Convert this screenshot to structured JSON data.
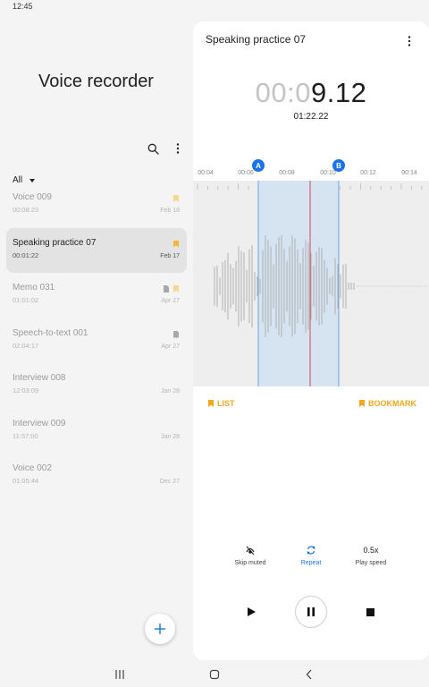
{
  "status_bar": {
    "time": "12:45"
  },
  "left_pane": {
    "title": "Voice recorder",
    "filter_label": "All",
    "recordings": [
      {
        "name": "Voice 009",
        "duration": "00:08:23",
        "date": "Feb 18",
        "bookmark": true,
        "has_doc": false,
        "selected": false
      },
      {
        "name": "Speaking practice 07",
        "duration": "00:01:22",
        "date": "Feb 17",
        "bookmark": true,
        "has_doc": false,
        "selected": true
      },
      {
        "name": "Memo 031",
        "duration": "01:01:02",
        "date": "Apr 27",
        "bookmark": true,
        "has_doc": true,
        "selected": false
      },
      {
        "name": "Speech-to-text 001",
        "duration": "02:04:17",
        "date": "Apr 27",
        "bookmark": false,
        "has_doc": true,
        "selected": false
      },
      {
        "name": "Interview 008",
        "duration": "12:03:09",
        "date": "Jan 28",
        "bookmark": false,
        "has_doc": false,
        "selected": false
      },
      {
        "name": "Interview 009",
        "duration": "11:57:00",
        "date": "Jan 28",
        "bookmark": false,
        "has_doc": false,
        "selected": false
      },
      {
        "name": "Voice 002",
        "duration": "01:05:44",
        "date": "Dec 27",
        "bookmark": false,
        "has_doc": false,
        "selected": false
      }
    ]
  },
  "player": {
    "title": "Speaking practice 07",
    "elapsed_dim": "00:0",
    "elapsed_bright": "9.12",
    "total": "01:22.22",
    "ruler_ticks": [
      "00:04",
      "00:06",
      "00:08",
      "00:10",
      "00:12",
      "00:14"
    ],
    "marker_a": "A",
    "marker_b": "B",
    "list_label": "LIST",
    "bookmark_label": "BOOKMARK",
    "options": {
      "skip_muted": "Skip muted",
      "repeat": "Repeat",
      "speed_value": "0.5x",
      "speed_label": "Play speed"
    }
  },
  "colors": {
    "accent": "#1a73e8",
    "bookmark": "#f0a81c",
    "selection": "#d6e4f2",
    "playhead": "#d9445a"
  }
}
